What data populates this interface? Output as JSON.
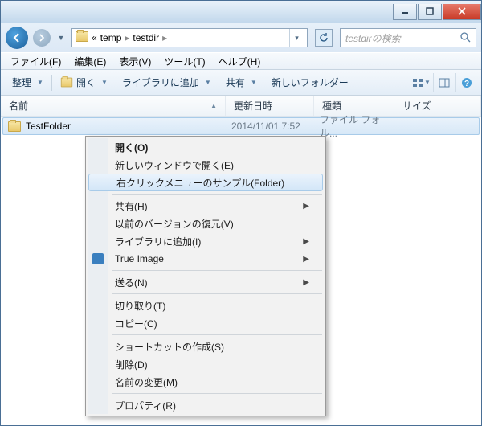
{
  "address": {
    "prefix": "«",
    "seg1": "temp",
    "seg2": "testdir"
  },
  "search": {
    "placeholder": "testdirの検索"
  },
  "menubar": {
    "file": "ファイル(F)",
    "edit": "編集(E)",
    "view": "表示(V)",
    "tools": "ツール(T)",
    "help": "ヘルプ(H)"
  },
  "toolbar": {
    "organize": "整理",
    "open": "開く",
    "addlib": "ライブラリに追加",
    "share": "共有",
    "newfolder": "新しいフォルダー"
  },
  "columns": {
    "name": "名前",
    "date": "更新日時",
    "type": "種類",
    "size": "サイズ"
  },
  "row": {
    "name": "TestFolder",
    "date": "2014/11/01 7:52",
    "type": "ファイル フォル..."
  },
  "ctx": {
    "open": "開く(O)",
    "newwin": "新しいウィンドウで開く(E)",
    "sample": "右クリックメニューのサンプル(Folder)",
    "share": "共有(H)",
    "restore": "以前のバージョンの復元(V)",
    "addlib": "ライブラリに追加(I)",
    "trueimage": "True Image",
    "send": "送る(N)",
    "cut": "切り取り(T)",
    "copy": "コピー(C)",
    "shortcut": "ショートカットの作成(S)",
    "delete": "削除(D)",
    "rename": "名前の変更(M)",
    "props": "プロパティ(R)"
  }
}
